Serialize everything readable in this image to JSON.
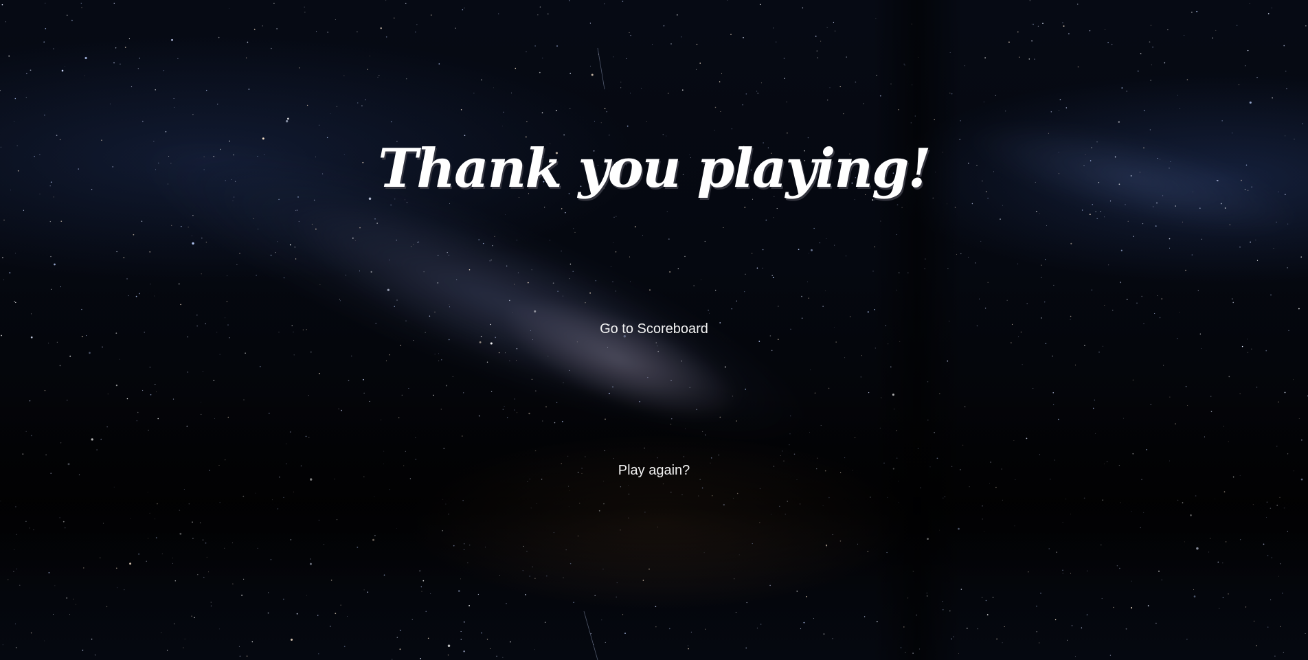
{
  "title": "Thank you playing!",
  "menu": {
    "scoreboard_label": "Go to Scoreboard",
    "play_again_label": "Play again?"
  },
  "colors": {
    "text": "#ffffff",
    "background": "#05070d",
    "sky_glow": "#3a4a7a"
  }
}
